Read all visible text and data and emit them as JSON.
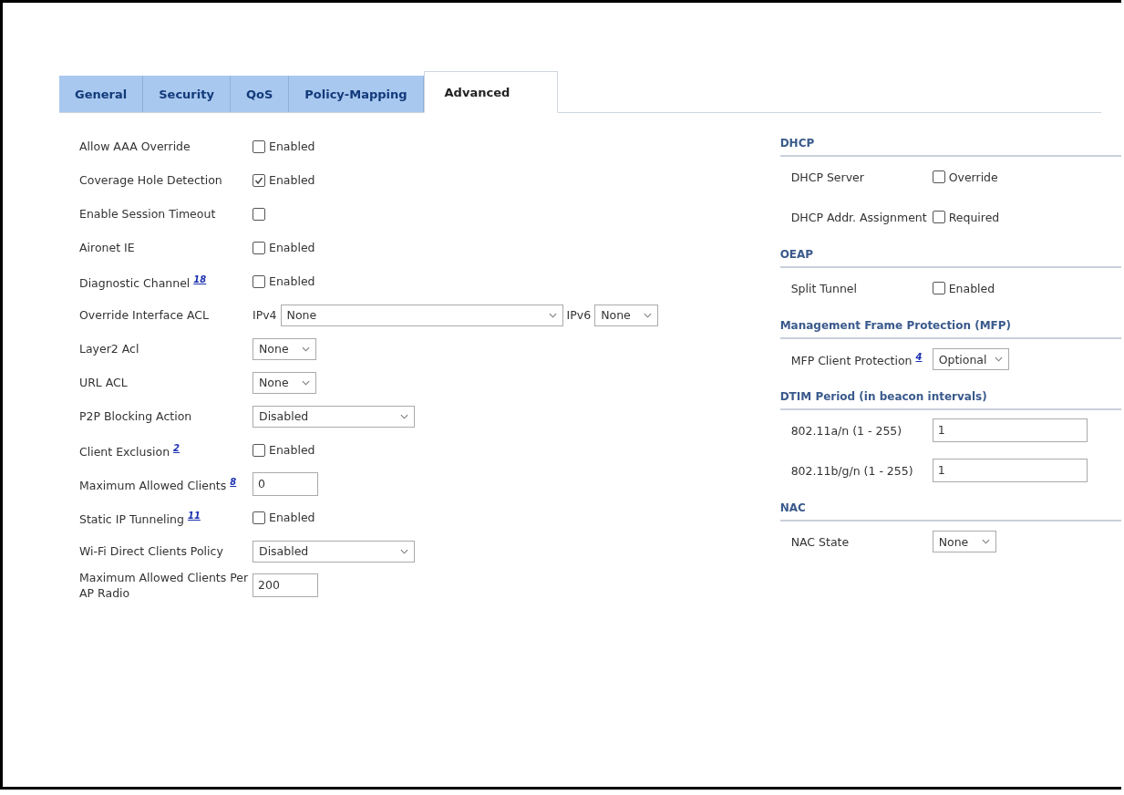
{
  "tabs": [
    {
      "label": "General",
      "selected": false
    },
    {
      "label": "Security",
      "selected": false
    },
    {
      "label": "QoS",
      "selected": false
    },
    {
      "label": "Policy-Mapping",
      "selected": false
    },
    {
      "label": "Advanced",
      "selected": true
    }
  ],
  "left_rows": [
    {
      "kind": "checkbox",
      "label": "Allow AAA Override",
      "checked": false,
      "option": "Enabled"
    },
    {
      "kind": "checkbox",
      "label": "Coverage Hole Detection",
      "checked": true,
      "option": "Enabled"
    },
    {
      "kind": "checkbox",
      "label": "Enable Session Timeout",
      "checked": false
    },
    {
      "kind": "checkbox",
      "label": "Aironet IE",
      "checked": false,
      "option": "Enabled"
    },
    {
      "kind": "checkbox",
      "label": "Diagnostic Channel",
      "note": "18",
      "checked": false,
      "option": "Enabled"
    },
    {
      "kind": "acl",
      "label": "Override Interface ACL",
      "parts": [
        {
          "prefix": "IPv4",
          "value": "None"
        },
        {
          "prefix": "IPv6",
          "value": "None"
        }
      ]
    },
    {
      "kind": "select",
      "label": "Layer2 Acl",
      "value": "None"
    },
    {
      "kind": "select",
      "label": "URL ACL",
      "value": "None"
    },
    {
      "kind": "select",
      "label": "P2P Blocking Action",
      "value": "Disabled"
    },
    {
      "kind": "checkbox",
      "label": "Client Exclusion",
      "note": "2",
      "checked": false,
      "option": "Enabled"
    },
    {
      "kind": "text",
      "label": "Maximum Allowed Clients",
      "note": "8",
      "value": "0"
    },
    {
      "kind": "checkbox",
      "label": "Static IP Tunneling",
      "note": "11",
      "checked": false,
      "option": "Enabled"
    },
    {
      "kind": "select",
      "label": "Wi-Fi Direct Clients Policy",
      "value": "Disabled"
    },
    {
      "kind": "text",
      "label": "Maximum Allowed Clients Per AP Radio",
      "value": "200"
    }
  ],
  "right_sections": [
    {
      "title": "DHCP",
      "rows": [
        {
          "kind": "checkbox",
          "label": "DHCP Server",
          "checked": false,
          "option": "Override"
        },
        {
          "kind": "checkbox",
          "label": "DHCP Addr. Assignment",
          "checked": false,
          "option": "Required"
        }
      ]
    },
    {
      "title": "OEAP",
      "rows": [
        {
          "kind": "checkbox",
          "label": "Split Tunnel",
          "checked": false,
          "option": "Enabled"
        }
      ]
    },
    {
      "title": "Management Frame Protection (MFP)",
      "rows": [
        {
          "kind": "select",
          "label": "MFP Client Protection",
          "note": "4",
          "value": "Optional"
        }
      ]
    },
    {
      "title": "DTIM Period (in beacon intervals)",
      "rows": [
        {
          "kind": "text",
          "label": "802.11a/n (1 - 255)",
          "value": "1"
        },
        {
          "kind": "text",
          "label": "802.11b/g/n (1 - 255)",
          "value": "1"
        }
      ]
    },
    {
      "title": "NAC",
      "rows": [
        {
          "kind": "select",
          "label": "NAC State",
          "value": "None"
        }
      ]
    }
  ]
}
